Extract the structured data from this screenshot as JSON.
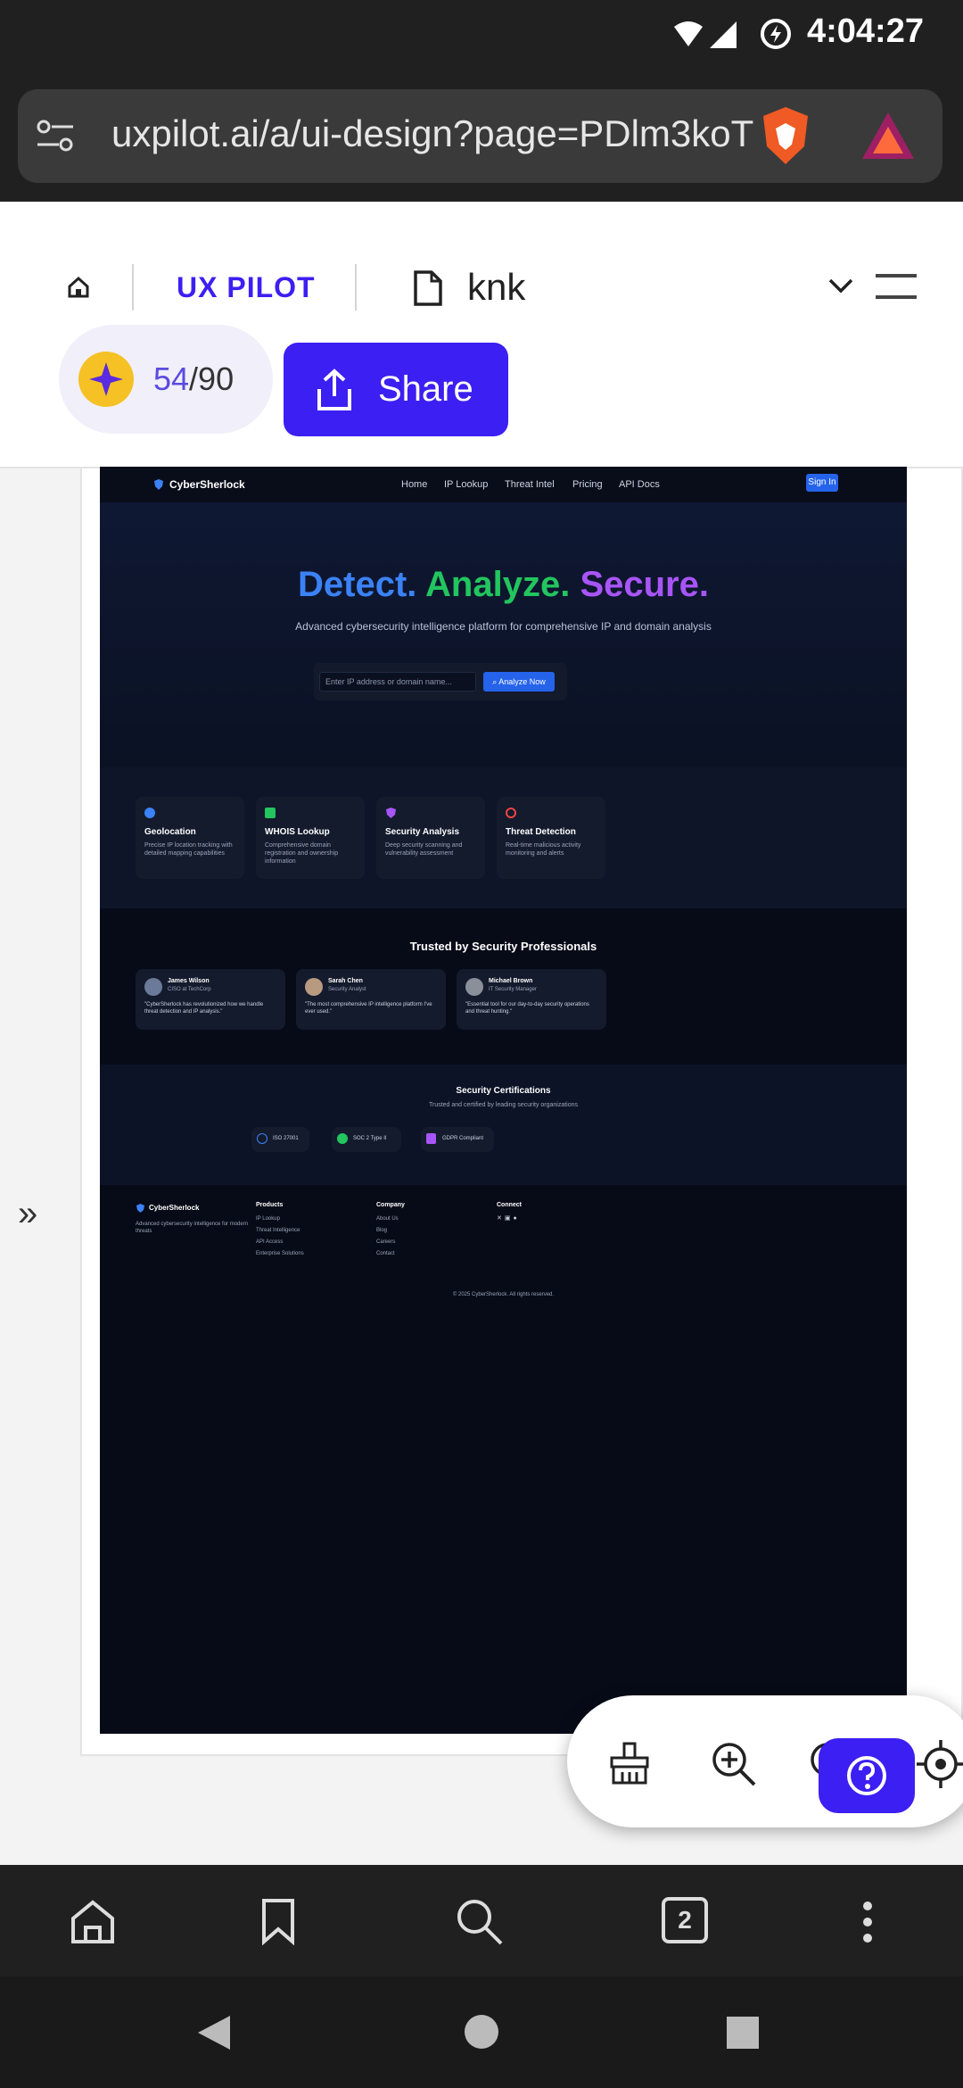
{
  "status_bar": {
    "time": "4:04:27"
  },
  "browser": {
    "url": "uxpilot.ai/a/ui-design?page=PDlm3koT"
  },
  "app": {
    "logo": "UX PILOT",
    "file_name": "knk",
    "credits_used": "54",
    "credits_total": "/90",
    "share_label": "Share"
  },
  "design": {
    "brand": "CyberSherlock",
    "nav": [
      "Home",
      "IP Lookup",
      "Threat Intel",
      "Pricing",
      "API Docs"
    ],
    "signin": "Sign In",
    "hero": {
      "title_1": "Detect.",
      "title_2": "Analyze.",
      "title_3": "Secure.",
      "subtitle": "Advanced cybersecurity intelligence platform for comprehensive IP and domain analysis",
      "search_placeholder": "Enter IP address or domain name...",
      "analyze_label": "Analyze Now"
    },
    "features": [
      {
        "title": "Geolocation",
        "desc": "Precise IP location tracking with detailed mapping capabilities"
      },
      {
        "title": "WHOIS Lookup",
        "desc": "Comprehensive domain registration and ownership information"
      },
      {
        "title": "Security Analysis",
        "desc": "Deep security scanning and vulnerability assessment"
      },
      {
        "title": "Threat Detection",
        "desc": "Real-time malicious activity monitoring and alerts"
      }
    ],
    "trusted_title": "Trusted by Security Professionals",
    "testimonials": [
      {
        "name": "James Wilson",
        "role": "CISO at TechCorp",
        "quote": "\"CyberSherlock has revolutionized how we handle threat detection and IP analysis.\""
      },
      {
        "name": "Sarah Chen",
        "role": "Security Analyst",
        "quote": "\"The most comprehensive IP intelligence platform I've ever used.\""
      },
      {
        "name": "Michael Brown",
        "role": "IT Security Manager",
        "quote": "\"Essential tool for our day-to-day security operations and threat hunting.\""
      }
    ],
    "cert_title": "Security Certifications",
    "cert_subtitle": "Trusted and certified by leading security organizations",
    "certs": [
      "ISO 27001",
      "SOC 2 Type II",
      "GDPR Compliant"
    ],
    "footer": {
      "tagline": "Advanced cybersecurity intelligence for modern threats",
      "products_title": "Products",
      "products": [
        "IP Lookup",
        "Threat Intelligence",
        "API Access",
        "Enterprise Solutions"
      ],
      "company_title": "Company",
      "company": [
        "About Us",
        "Blog",
        "Careers",
        "Contact"
      ],
      "connect_title": "Connect",
      "copyright": "© 2025 CyberSherlock. All rights reserved."
    }
  },
  "bottom_nav": {
    "tab_count": "2"
  },
  "colors": {
    "accent": "#3c1ff2",
    "hero_blue": "#3b82f6",
    "hero_green": "#22c55e",
    "hero_purple": "#a855f7"
  }
}
